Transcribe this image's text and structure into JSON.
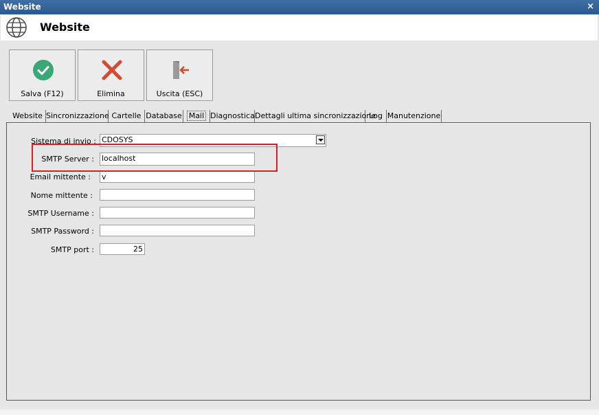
{
  "window": {
    "title": "Website",
    "close_glyph": "×"
  },
  "header": {
    "title": "Website",
    "icon": "globe-icon"
  },
  "toolbar": {
    "save": {
      "label": "Salva (F12)",
      "icon": "checkmark-icon",
      "color": "#3aa776"
    },
    "delete": {
      "label": "Elimina",
      "icon": "x-icon",
      "color": "#d24a2f"
    },
    "exit": {
      "label": "Uscita (ESC)",
      "icon": "exit-door-icon",
      "color": "#d24a2f"
    }
  },
  "tabs": [
    "Website",
    "Sincronizzazione",
    "Cartelle",
    "Database",
    "Mail",
    "Diagnostica",
    "Dettagli ultima sincronizzazione",
    "Log",
    "Manutenzione"
  ],
  "active_tab": "Mail",
  "form": {
    "sistema_label": "Sistema di invio :",
    "sistema_value": "CDOSYS",
    "smtp_server_label": "SMTP Server :",
    "smtp_server_value": "localhost",
    "email_mittente_label": "Email mittente :",
    "email_mittente_value": "v",
    "nome_mittente_label": "Nome mittente :",
    "nome_mittente_value": "",
    "smtp_username_label": "SMTP Username :",
    "smtp_username_value": "",
    "smtp_password_label": "SMTP Password :",
    "smtp_password_value": "",
    "smtp_port_label": "SMTP port :",
    "smtp_port_value": "25"
  },
  "colors": {
    "titlebar": "#2f5f94",
    "highlight": "#d61f1f"
  }
}
